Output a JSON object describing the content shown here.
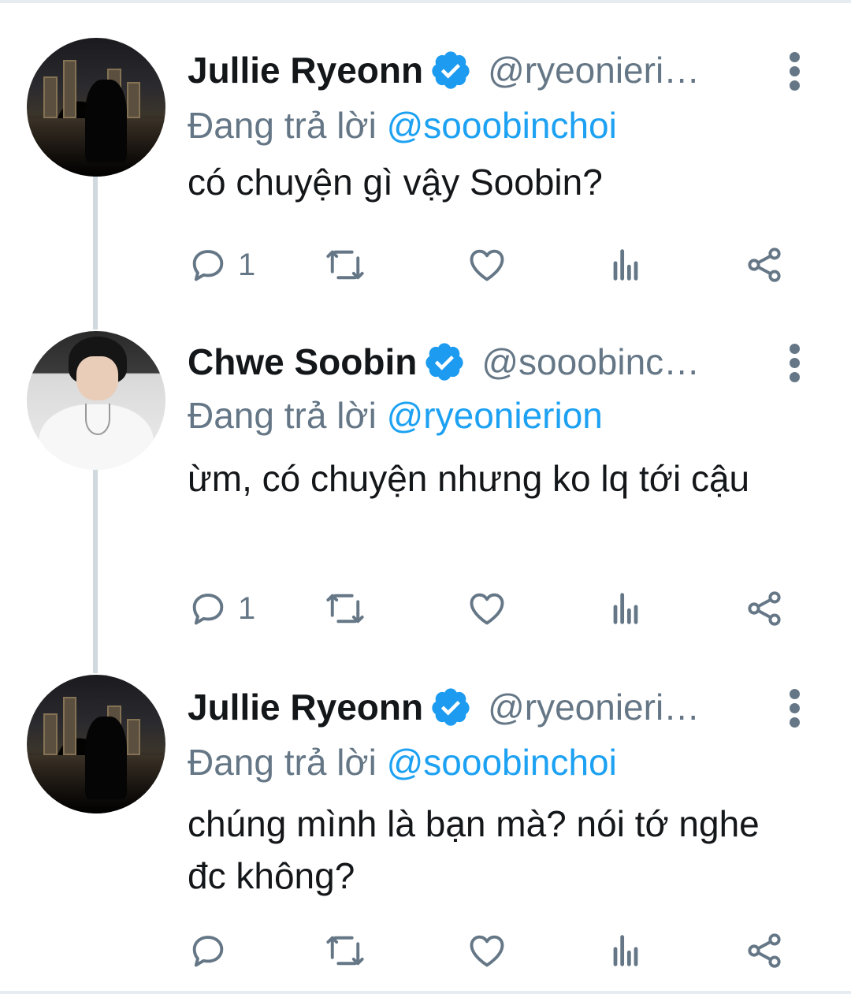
{
  "tweets": [
    {
      "author": "Jullie Ryeonn",
      "handle": "@ryeonieri…",
      "reply_prefix": "Đang trả lời",
      "reply_to": "@sooobinchoi",
      "text": "có chuyện gì vậy Soobin?",
      "reply_count": "1",
      "avatar": "city-night-silhouette"
    },
    {
      "author": "Chwe Soobin",
      "handle": "@sooobinc…",
      "reply_prefix": "Đang trả lời",
      "reply_to": "@ryeonierion",
      "text": "ừm, có chuyện nhưng ko lq tới cậu",
      "reply_count": "1",
      "avatar": "boy-white-shirt"
    },
    {
      "author": "Jullie Ryeonn",
      "handle": "@ryeonieri…",
      "reply_prefix": "Đang trả lời",
      "reply_to": "@sooobinchoi",
      "text": "chúng mình là bạn mà? nói tớ nghe đc không?",
      "reply_count": "",
      "avatar": "city-night-silhouette"
    }
  ],
  "icons": {
    "reply": "speech-bubble-icon",
    "retweet": "retweet-icon",
    "like": "heart-icon",
    "views": "bar-chart-icon",
    "share": "share-icon",
    "more": "more-vertical-icon",
    "verified": "verified-badge-icon"
  },
  "colors": {
    "text": "#14171a",
    "secondary": "#657786",
    "link": "#1da1f2",
    "verified": "#1d9bf0",
    "thread_line": "#cfd9de"
  }
}
